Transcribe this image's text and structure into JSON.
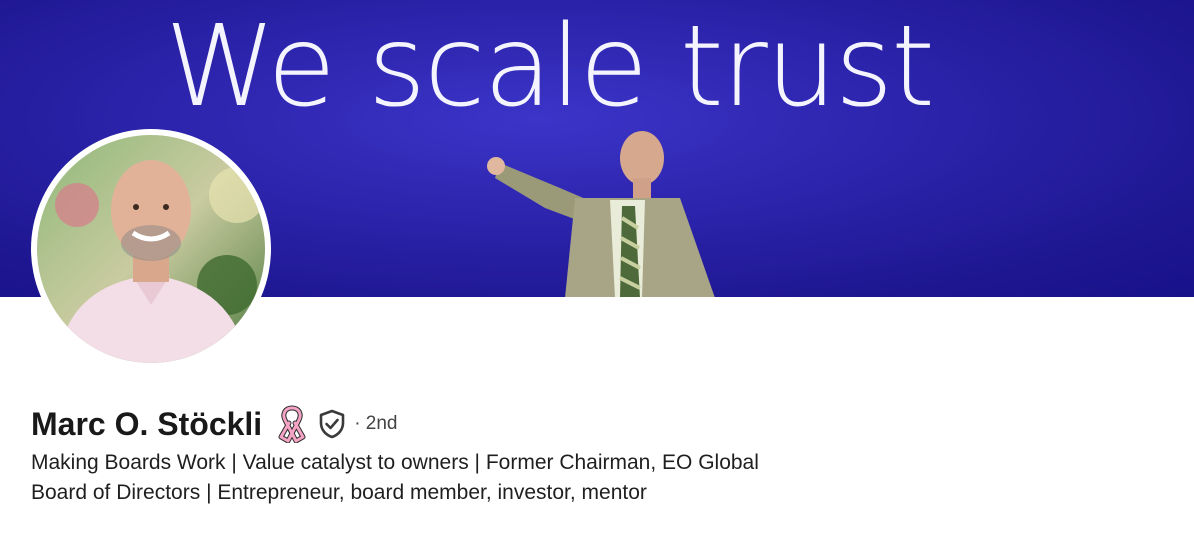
{
  "banner": {
    "text": "We scale trust",
    "bg_color": "#2a22a8"
  },
  "profile": {
    "name": "Marc O. Stöckli",
    "ribbon_icon": "pink-ribbon-icon",
    "verified_icon": "verified-shield-icon",
    "degree": "· 2nd",
    "headline": "Making Boards Work | Value catalyst to owners | Former Chairman, EO Global Board of Directors | Entrepreneur, board member, investor, mentor"
  }
}
